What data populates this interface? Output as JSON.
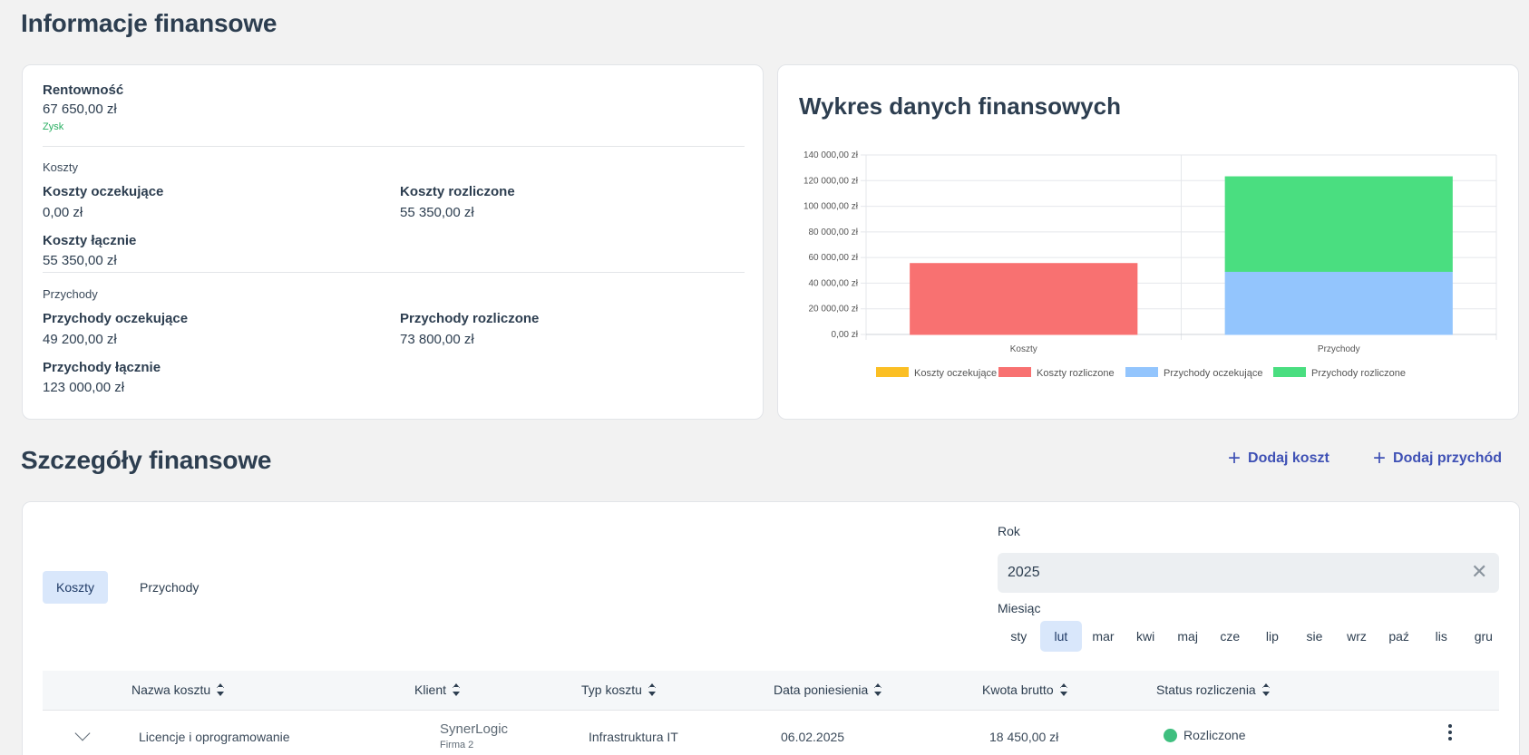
{
  "info": {
    "title": "Informacje finansowe",
    "rentownosc_label": "Rentowność",
    "rentownosc_value": "67 650,00 zł",
    "rentownosc_status": "Zysk",
    "koszty_section": "Koszty",
    "koszty_oczekujace_label": "Koszty oczekujące",
    "koszty_oczekujace_value": "0,00 zł",
    "koszty_rozliczone_label": "Koszty rozliczone",
    "koszty_rozliczone_value": "55 350,00 zł",
    "koszty_lacznie_label": "Koszty łącznie",
    "koszty_lacznie_value": "55 350,00 zł",
    "przychody_section": "Przychody",
    "przychody_oczekujace_label": "Przychody oczekujące",
    "przychody_oczekujace_value": "49 200,00 zł",
    "przychody_rozliczone_label": "Przychody rozliczone",
    "przychody_rozliczone_value": "73 800,00 zł",
    "przychody_lacznie_label": "Przychody łącznie",
    "przychody_lacznie_value": "123 000,00 zł"
  },
  "chart_data": {
    "type": "bar",
    "stacked": true,
    "title": "Wykres danych finansowych",
    "categories": [
      "Koszty",
      "Przychody"
    ],
    "series": [
      {
        "name": "Koszty oczekujące",
        "color": "#fbbf24",
        "values": [
          0,
          0
        ]
      },
      {
        "name": "Koszty rozliczone",
        "color": "#f87171",
        "values": [
          55350,
          0
        ]
      },
      {
        "name": "Przychody oczekujące",
        "color": "#93c5fd",
        "values": [
          0,
          49200
        ]
      },
      {
        "name": "Przychody rozliczone",
        "color": "#4ade80",
        "values": [
          0,
          73800
        ]
      }
    ],
    "ylim": [
      0,
      140000
    ],
    "yticks": [
      "0,00 zł",
      "20 000,00 zł",
      "40 000,00 zł",
      "60 000,00 zł",
      "80 000,00 zł",
      "100 000,00 zł",
      "120 000,00 zł",
      "140 000,00 zł"
    ],
    "grid": true,
    "legend": "bottom"
  },
  "details": {
    "title": "Szczegóły finansowe",
    "add_cost": "Dodaj koszt",
    "add_income": "Dodaj przychód",
    "tabs": [
      {
        "label": "Koszty",
        "active": true
      },
      {
        "label": "Przychody",
        "active": false
      }
    ],
    "rok_label": "Rok",
    "rok_value": "2025",
    "miesiac_label": "Miesiąc",
    "months": [
      "sty",
      "lut",
      "mar",
      "kwi",
      "maj",
      "cze",
      "lip",
      "sie",
      "wrz",
      "paź",
      "lis",
      "gru"
    ],
    "active_month": "lut",
    "columns": [
      "Nazwa kosztu",
      "Klient",
      "Typ kosztu",
      "Data poniesienia",
      "Kwota brutto",
      "Status rozliczenia"
    ],
    "rows": [
      {
        "name": "Licencje i oprogramowanie",
        "client": "SynerLogic",
        "client_sub": "Firma 2",
        "type": "Infrastruktura IT",
        "date": "06.02.2025",
        "amount": "18 450,00 zł",
        "status": "Rozliczone",
        "status_color": "#3fbf7f"
      }
    ]
  }
}
